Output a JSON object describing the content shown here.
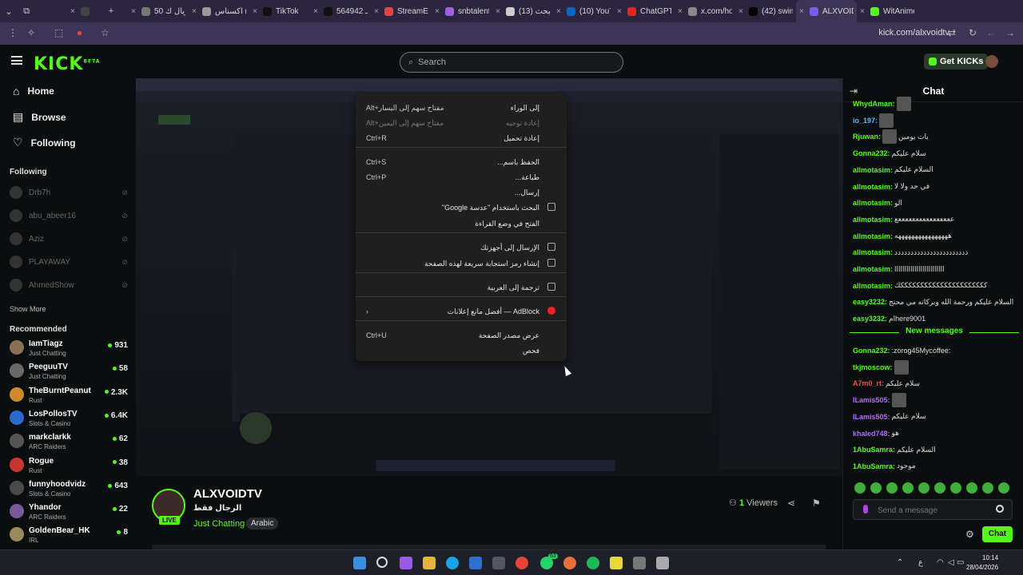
{
  "browser": {
    "tabs": [
      {
        "title": "",
        "color": "#444"
      },
      {
        "title": "50 ريال ك",
        "color": "#777"
      },
      {
        "title": "اكسناس (",
        "color": "#999"
      },
      {
        "title": "TikTok",
        "color": "#111"
      },
      {
        "title": "564942 هـ",
        "color": "#111"
      },
      {
        "title": "StreamEle",
        "color": "#d44"
      },
      {
        "title": "snbtalent",
        "color": "#a060e0"
      },
      {
        "title": "(13) البحث",
        "color": "#ccc"
      },
      {
        "title": "(10) YouTu",
        "color": "#0a66c2"
      },
      {
        "title": "ChatGPT",
        "color": "#e22"
      },
      {
        "title": "x.com/hon",
        "color": "#888"
      },
      {
        "title": "(42) swim",
        "color": "#000"
      },
      {
        "title": "ALXVOIDT",
        "color": "#7e5bef"
      },
      {
        "title": "WitAnime",
        "color": "#53fc18"
      }
    ],
    "url": "kick.com/alxvoidtv"
  },
  "header": {
    "logo": "KICK",
    "logo_badge": "BETA",
    "search_placeholder": "Search",
    "get_kicks": "Get KICKs"
  },
  "sidebar": {
    "nav": [
      {
        "label": "Home",
        "icon": "home-icon"
      },
      {
        "label": "Browse",
        "icon": "browse-icon"
      },
      {
        "label": "Following",
        "icon": "heart-icon"
      }
    ],
    "following_title": "Following",
    "following": [
      "Drb7h",
      "abu_abeer16",
      "Aziz",
      "PLAYAWAY",
      "AhmedShow"
    ],
    "show_more": "Show More",
    "recommended_title": "Recommended",
    "recommended": [
      {
        "name": "IamTiagz",
        "category": "Just Chatting",
        "viewers": "931",
        "color": "#8a7050"
      },
      {
        "name": "PeeguuTV",
        "category": "Just Chatting",
        "viewers": "58",
        "color": "#6a6a6a"
      },
      {
        "name": "TheBurntPeanut",
        "category": "Rust",
        "viewers": "2.3K",
        "color": "#d08a2a"
      },
      {
        "name": "LosPollosTV",
        "category": "Slots & Casino",
        "viewers": "6.4K",
        "color": "#2a6ad0"
      },
      {
        "name": "markclarkk",
        "category": "ARC Raiders",
        "viewers": "62",
        "color": "#555"
      },
      {
        "name": "Rogue",
        "category": "Rust",
        "viewers": "38",
        "color": "#c33"
      },
      {
        "name": "funnyhoodvidz",
        "category": "Slots & Casino",
        "viewers": "643",
        "color": "#4a4a4a"
      },
      {
        "name": "Yhandor",
        "category": "ARC Raiders",
        "viewers": "22",
        "color": "#7a5a9a"
      },
      {
        "name": "GoldenBear_HK",
        "category": "IRL",
        "viewers": "8",
        "color": "#9a8a5a"
      }
    ]
  },
  "context_menu": {
    "items": [
      {
        "label": "إلى الوراء",
        "shortcut": "Alt+مفتاح سهم إلى اليسار",
        "dim": false
      },
      {
        "label": "إعادة توجيه",
        "shortcut": "Alt+مفتاح سهم إلى اليمين",
        "dim": true
      },
      {
        "label": "إعادة تحميل",
        "shortcut": "Ctrl+R",
        "dim": false
      },
      {
        "label": "الحفظ باسم...",
        "shortcut": "Ctrl+S",
        "dim": false
      },
      {
        "label": "طباعة...",
        "shortcut": "Ctrl+P",
        "dim": false
      },
      {
        "label": "إرسال...",
        "shortcut": "",
        "dim": false
      },
      {
        "label": "البحث باستخدام \"عدسة Google\"",
        "shortcut": "",
        "dim": false
      },
      {
        "label": "الفتح في وضع القراءة",
        "shortcut": "",
        "dim": false
      },
      {
        "label": "الإرسال إلى أجهزتك",
        "shortcut": "",
        "dim": false
      },
      {
        "label": "إنشاء رمز استجابة سريعة لهذه الصفحة",
        "shortcut": "",
        "dim": false
      },
      {
        "label": "ترجمة إلى العربية",
        "shortcut": "",
        "dim": false
      },
      {
        "label": "AdBlock — أفضل مانع إعلانات",
        "shortcut": "›",
        "dim": false
      },
      {
        "label": "عرض مصدر الصفحة",
        "shortcut": "Ctrl+U",
        "dim": false
      },
      {
        "label": "فحص",
        "shortcut": "",
        "dim": false
      }
    ]
  },
  "stream": {
    "channel": "ALXVOIDTV",
    "live_badge": "LIVE",
    "title": "الرجال فقط",
    "category": "Just Chatting",
    "tag": "Arabic",
    "viewers_count": "1",
    "viewers_label": "Viewers"
  },
  "chat": {
    "title": "Chat",
    "messages": [
      {
        "user": "WhydAman:",
        "text": "",
        "color": "#53fc18",
        "emote": true
      },
      {
        "user": "io_197:",
        "text": "",
        "color": "#53c0fc",
        "emote": true
      },
      {
        "user": "Rjuwan:",
        "text": "يات يومين",
        "color": "#53fc18",
        "emote": true
      },
      {
        "user": "Gonna232:",
        "text": "سلام عليكم",
        "color": "#53fc18",
        "emote": false
      },
      {
        "user": "allmotasim:",
        "text": "السلام عليكم",
        "color": "#53fc18",
        "emote": false
      },
      {
        "user": "allmotasim:",
        "text": "في حد ولا لا",
        "color": "#53fc18",
        "emote": false
      },
      {
        "user": "allmotasim:",
        "text": "الو",
        "color": "#53fc18",
        "emote": false
      },
      {
        "user": "allmotasim:",
        "text": "ععععععععععععععععع",
        "color": "#53fc18",
        "emote": false
      },
      {
        "user": "allmotasim:",
        "text": "ههههههههههههههههه",
        "color": "#53fc18",
        "emote": false
      },
      {
        "user": "allmotasim:",
        "text": "ددددددددددددددددددددددد",
        "color": "#53fc18",
        "emote": false
      },
      {
        "user": "allmotasim:",
        "text": "ااااااااااااااااااااااااا",
        "color": "#53fc18",
        "emote": false
      },
      {
        "user": "allmotasim:",
        "text": "ككككككككككككككككككككككك",
        "color": "#53fc18",
        "emote": false
      },
      {
        "user": "easy3232:",
        "text": "السلام عليكم ورحمة الله وبركاته مي محتج",
        "color": "#53fc18",
        "emote": false
      },
      {
        "user": "easy3232:",
        "text": "امhere9001",
        "color": "#53fc18",
        "emote": false
      }
    ],
    "new_messages_label": "New messages",
    "new_messages": [
      {
        "user": "Gonna232:",
        "text": ":zorog45Mycoffee:",
        "color": "#53fc18",
        "emote": false
      },
      {
        "user": "tkjmoscow:",
        "text": "",
        "color": "#53fc18",
        "emote": true
      },
      {
        "user": "A7m0_rt:",
        "text": "سلام عليكم",
        "color": "#fc4b4b",
        "emote": false
      },
      {
        "user": "ILamis505:",
        "text": "",
        "color": "#b36cf5",
        "emote": true
      },
      {
        "user": "ILamis505:",
        "text": "سلام عليكم",
        "color": "#b36cf5",
        "emote": false
      },
      {
        "user": "khaled748:",
        "text": "هو",
        "color": "#b36cf5",
        "emote": false
      },
      {
        "user": "1AbuSamra:",
        "text": "السلام عليكم",
        "color": "#53fc18",
        "emote": false
      },
      {
        "user": "1AbuSamra:",
        "text": "موجود",
        "color": "#53fc18",
        "emote": false
      }
    ],
    "input_placeholder": "Send a message",
    "send_label": "Chat"
  },
  "taskbar": {
    "lang": "ع",
    "time": "10:14",
    "date": "28/04/2026",
    "whatsapp_badge": "63"
  }
}
